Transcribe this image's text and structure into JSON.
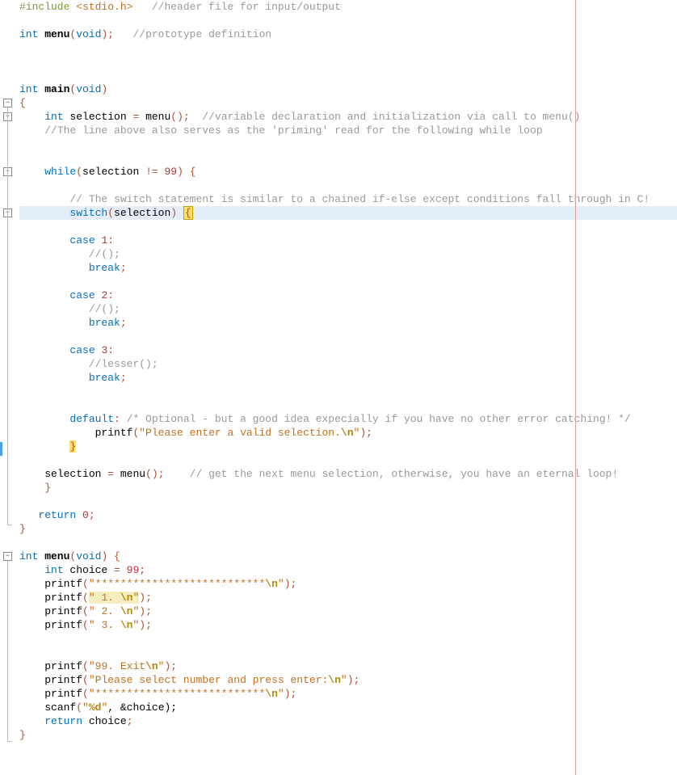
{
  "lines": {
    "l1_include": "#include",
    "l1_header": " <stdio.h>",
    "l1_cmt": "   //header file for input/output",
    "l3_type": "int",
    "l3_fn": " menu",
    "l3_op1": "(",
    "l3_void": "void",
    "l3_op2": ");",
    "l3_cmt": "   //prototype definition",
    "l7_type": "int",
    "l7_fn": " main",
    "l7_op1": "(",
    "l7_void": "void",
    "l7_op2": ")",
    "l8_brace": "{",
    "l9_indent": "    ",
    "l9_type": "int",
    "l9_var": " selection ",
    "l9_eq": "=",
    "l9_call": " menu",
    "l9_op": "();",
    "l9_cmt": "  //variable declaration and initialization via call to menu()",
    "l10_indent": "    ",
    "l10_cmt": "//The line above also serves as the 'priming' read for the following while loop",
    "l13_indent": "    ",
    "l13_while": "while",
    "l13_op1": "(",
    "l13_var": "selection ",
    "l13_neq": "!=",
    "l13_sp": " ",
    "l13_num": "99",
    "l13_op2": ") {",
    "l15_indent": "        ",
    "l15_cmt": "// The switch statement is similar to a chained if-else except conditions fall through in C!",
    "l16_indent": "        ",
    "l16_switch": "switch",
    "l16_op1": "(",
    "l16_var": "selection",
    "l16_op2": ") ",
    "l16_brace": "{",
    "l18_indent": "        ",
    "l18_case": "case",
    "l18_sp": " ",
    "l18_num": "1",
    "l18_colon": ":",
    "l19_indent": "           ",
    "l19_cmt": "//();",
    "l20_indent": "           ",
    "l20_break": "break",
    "l20_semi": ";",
    "l22_case": "case",
    "l22_num": "2",
    "l23_cmt": "//();",
    "l26_case": "case",
    "l26_num": "3",
    "l27_indent": "           ",
    "l27_cmt": "//lesser();",
    "l31_indent": "        ",
    "l31_default": "default",
    "l31_colon": ":",
    "l31_cmt": " /* Optional - but a good idea expecially if you have no other error catching! */",
    "l32_indent": "            ",
    "l32_printf": "printf",
    "l32_op1": "(",
    "l32_str": "\"Please enter a valid selection.",
    "l32_esc": "\\n",
    "l32_strend": "\"",
    "l32_op2": ");",
    "l33_indent": "        ",
    "l33_brace": "}",
    "l35_indent": "    ",
    "l35_var": "selection ",
    "l35_eq": "=",
    "l35_call": " menu",
    "l35_op": "();",
    "l35_cmt": "    // get the next menu selection, otherwise, you have an eternal loop!",
    "l36_indent": "    ",
    "l36_brace": "}",
    "l38_indent": "   ",
    "l38_return": "return",
    "l38_sp": " ",
    "l38_num": "0",
    "l38_semi": ";",
    "l39_brace": "}",
    "l41_type": "int",
    "l41_fn": " menu",
    "l41_op1": "(",
    "l41_void": "void",
    "l41_op2": ") {",
    "l42_indent": "    ",
    "l42_type": "int",
    "l42_var": " choice ",
    "l42_eq": "=",
    "l42_sp": " ",
    "l42_num": "99",
    "l42_semi": ";",
    "l43_indent": "    ",
    "l43_printf": "printf",
    "l43_op1": "(",
    "l43_str": "\"***************************",
    "l43_esc": "\\n",
    "l43_strend": "\"",
    "l43_op2": ");",
    "l44_str": "\" 1. ",
    "l44_esc": "\\n",
    "l44_strend": "\"",
    "l45_str": "\" 2. ",
    "l46_str": "\" 3. ",
    "l49_str": "\"99. Exit",
    "l50_str": "\"Please select number and press enter:",
    "l51_str": "\"***************************",
    "l52_indent": "    ",
    "l52_scanf": "scanf",
    "l52_op1": "(",
    "l52_str": "\"",
    "l52_fmt": "%d",
    "l52_strend": "\"",
    "l52_rest": ", &choice);",
    "l53_indent": "    ",
    "l53_return": "return",
    "l53_var": " choice",
    "l53_semi": ";",
    "l54_brace": "}"
  },
  "fold": {
    "minus": "−"
  }
}
